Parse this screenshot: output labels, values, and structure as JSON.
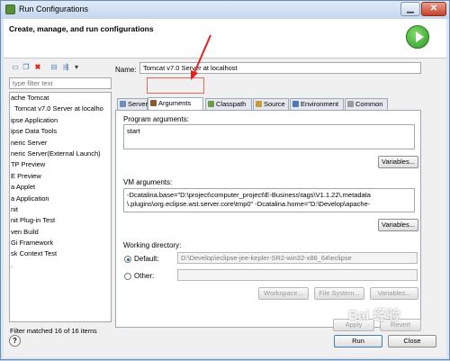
{
  "window": {
    "title": "Run Configurations"
  },
  "header": {
    "heading": "Create, manage, and run configurations"
  },
  "sidebar": {
    "filter_placeholder": "type filter text",
    "items": [
      "ache Tomcat",
      "Tomcat v7.0 Server at localho",
      "ipse Application",
      "ipse Data Tools",
      "neric Server",
      "neric Server(External Launch)",
      "TP Preview",
      "E Preview",
      "a Applet",
      "a Application",
      "nit",
      "nit Plug-in Test",
      "ven Build",
      "Gi Framework",
      "sk Context Test",
      "."
    ],
    "status": "Filter matched 16 of 16 items"
  },
  "config": {
    "name_label": "Name:",
    "name_value": "Tomcat v7.0 Server at localhost",
    "tabs": [
      "Server",
      "Arguments",
      "Classpath",
      "Source",
      "Environment",
      "Common"
    ],
    "program_args_label": "Program arguments:",
    "program_args_value": "start",
    "variables_label": "Variables...",
    "vm_args_label": "VM arguments:",
    "vm_args_line1": "-Dcatalina.base=\"D:\\project\\computer_project\\E-Business\\tags\\V1.1.22\\.metadata",
    "vm_args_line2": "\\.plugins\\org.eclipse.wst.server.core\\tmp0\" -Dcatalina.home=\"D:\\Develop\\apache-",
    "working_dir_label": "Working directory:",
    "default_label": "Default:",
    "default_value": "D:\\Develop\\eclipse-jee-kepler-SR2-win32-x86_64\\eclipse",
    "other_label": "Other:",
    "workspace_label": "Workspace...",
    "filesystem_label": "File System...",
    "apply_label": "Apply",
    "revert_label": "Revert"
  },
  "footer": {
    "run_label": "Run",
    "close_label": "Close"
  },
  "watermark": "Bai 经验",
  "colors": {
    "run_icon": "#2f9a25",
    "highlight_box": "#e06a5a",
    "arrow": "#e32020"
  }
}
